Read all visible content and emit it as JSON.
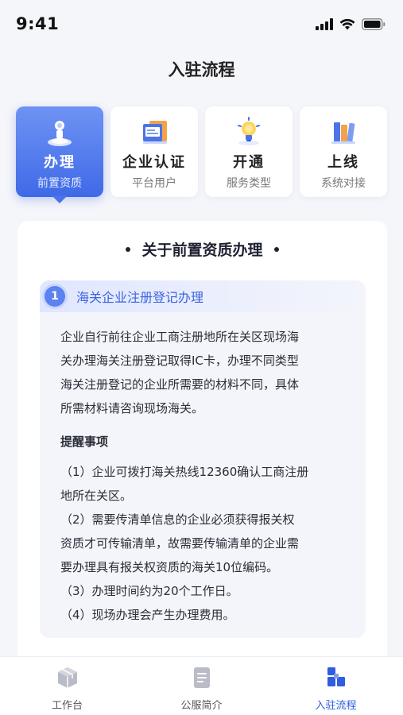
{
  "status_bar": {
    "time": "9:41"
  },
  "nav": {
    "title": "入驻流程"
  },
  "steps": [
    {
      "title": "办理",
      "subtitle": "前置资质",
      "icon": "stamp-icon",
      "active": true
    },
    {
      "title": "企业认证",
      "subtitle": "平台用户",
      "icon": "certificate-icon",
      "active": false
    },
    {
      "title": "开通",
      "subtitle": "服务类型",
      "icon": "lightbulb-icon",
      "active": false
    },
    {
      "title": "上线",
      "subtitle": "系统对接",
      "icon": "books-icon",
      "active": false
    }
  ],
  "section": {
    "title": "关于前置资质办理",
    "item": {
      "number": "1",
      "title": "海关企业注册登记办理",
      "description_lines": [
        "企业自行前往企业工商注册地所在关区现场海",
        "关办理海关注册登记取得IC卡，办理不同类型",
        "海关注册登记的企业所需要的材料不同，具体",
        "所需材料请咨询现场海关。"
      ],
      "remind_title": "提醒事项",
      "remind_lines": [
        "（1）企业可拨打海关热线12360确认工商注册",
        "地所在关区。",
        "（2）需要传清单信息的企业必须获得报关权",
        "资质才可传输清单，故需要传输清单的企业需",
        "要办理具有报关权资质的海关10位编码。",
        "（3）办理时间约为20个工作日。",
        "（4）现场办理会产生办理费用。"
      ]
    }
  },
  "tabbar": [
    {
      "label": "工作台",
      "icon": "cube-icon",
      "active": false
    },
    {
      "label": "公服简介",
      "icon": "document-icon",
      "active": false
    },
    {
      "label": "入驻流程",
      "icon": "blocks-icon",
      "active": true
    }
  ],
  "colors": {
    "accent": "#3f6ae8",
    "accent_light": "#6f93f3",
    "background": "#f5f6fa",
    "text_primary": "#1f2330",
    "tab_active": "#2f5ce0"
  }
}
